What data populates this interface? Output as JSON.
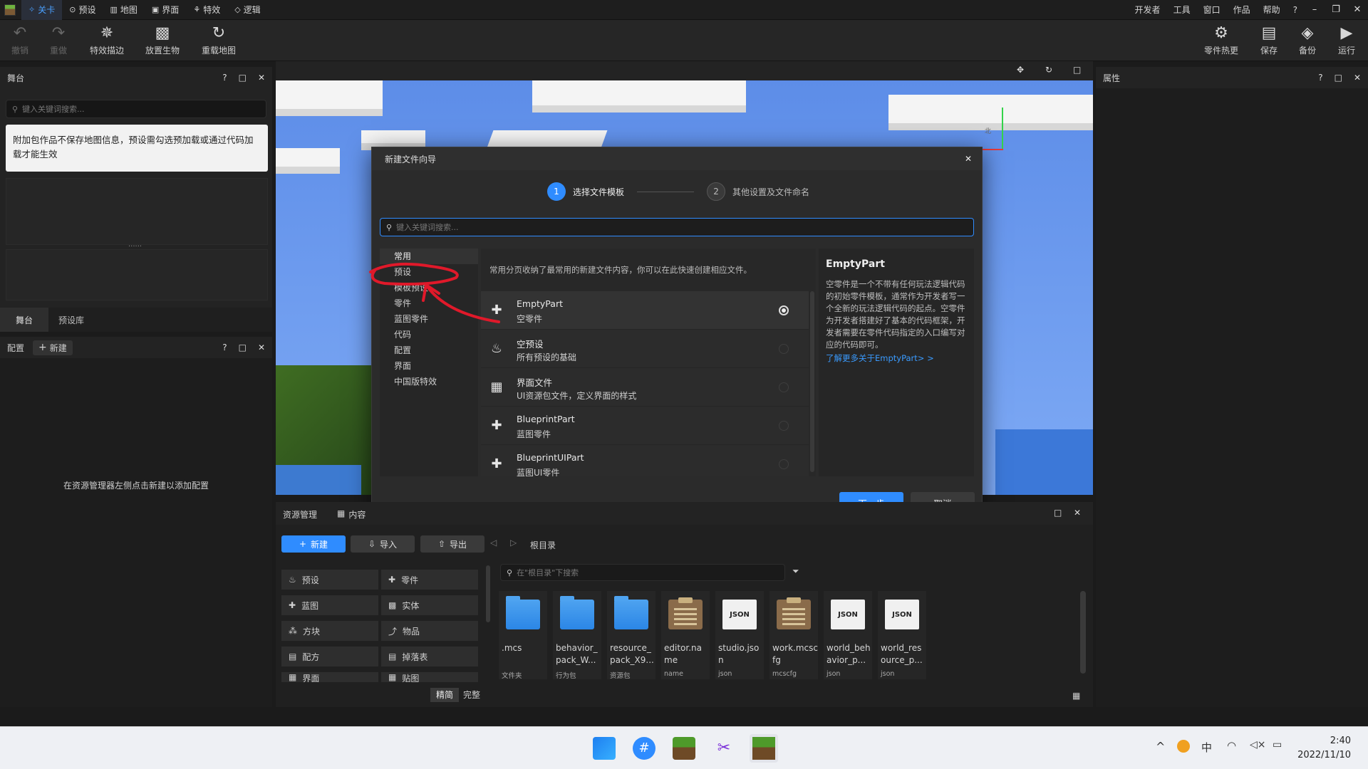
{
  "menubar": {
    "tabs": [
      {
        "label": "关卡",
        "icon": "level-icon",
        "active": true
      },
      {
        "label": "预设",
        "icon": "preset-icon"
      },
      {
        "label": "地图",
        "icon": "map-icon"
      },
      {
        "label": "界面",
        "icon": "ui-icon"
      },
      {
        "label": "特效",
        "icon": "effect-icon"
      },
      {
        "label": "逻辑",
        "icon": "logic-icon"
      }
    ],
    "right_items": [
      "开发者",
      "工具",
      "窗口",
      "作品",
      "帮助",
      "?"
    ]
  },
  "toolbar": {
    "undo": "撤销",
    "redo": "重做",
    "effect_stroke": "特效描边",
    "place_mob": "放置生物",
    "reload_map": "重载地图",
    "part_hotfix": "零件热更",
    "save": "保存",
    "backup": "备份",
    "run": "运行"
  },
  "stage_panel": {
    "title": "舞台",
    "search_placeholder": "键入关键词搜索...",
    "notice": "附加包作品不保存地图信息，预设需勾选预加载或通过代码加载才能生效",
    "splitter": "......",
    "tabs": [
      "舞台",
      "预设库"
    ]
  },
  "config_panel": {
    "title": "配置",
    "new_label": "新建",
    "empty_hint": "在资源管理器左侧点击新建以添加配置"
  },
  "properties_panel": {
    "title": "属性"
  },
  "viewport": {
    "gizmo_label": "北"
  },
  "dialog": {
    "title": "新建文件向导",
    "steps": [
      {
        "num": "1",
        "label": "选择文件模板"
      },
      {
        "num": "2",
        "label": "其他设置及文件命名"
      }
    ],
    "search_placeholder": "键入关键词搜索...",
    "categories": [
      "常用",
      "预设",
      "模板预设",
      "零件",
      "蓝图零件",
      "代码",
      "配置",
      "界面",
      "中国版特效"
    ],
    "description": "常用分页收纳了最常用的新建文件内容，你可以在此快速创建相应文件。",
    "templates": [
      {
        "name": "EmptyPart",
        "sub": "空零件",
        "selected": true
      },
      {
        "name": "空预设",
        "sub": "所有预设的基础",
        "selected": false
      },
      {
        "name": "界面文件",
        "sub": "UI资源包文件，定义界面的样式",
        "selected": false
      },
      {
        "name": "BlueprintPart",
        "sub": "蓝图零件",
        "selected": false
      },
      {
        "name": "BlueprintUIPart",
        "sub": "蓝图UI零件",
        "selected": false
      }
    ],
    "detail_title": "EmptyPart",
    "detail_text": "空零件是一个不带有任何玩法逻辑代码的初始零件模板，通常作为开发者写一个全新的玩法逻辑代码的起点。空零件为开发者搭建好了基本的代码框架，开发者需要在零件代码指定的入口编写对应的代码即可。",
    "detail_link": "了解更多关于EmptyPart> >",
    "next_button": "下一步",
    "cancel_button": "取消"
  },
  "assets": {
    "tab_label": "资源管理",
    "content_label": "内容",
    "new_button": "新建",
    "import_button": "导入",
    "export_button": "导出",
    "path": "根目录",
    "search_placeholder": "在\"根目录\"下搜索",
    "categories": [
      [
        "预设",
        "零件"
      ],
      [
        "蓝图",
        "实体"
      ],
      [
        "方块",
        "物品"
      ],
      [
        "配方",
        "掉落表"
      ],
      [
        "界面",
        "贴图"
      ]
    ],
    "view_modes": [
      "精简",
      "完整"
    ],
    "files": [
      {
        "name": ".mcs",
        "type": "文件夹",
        "kind": "folder"
      },
      {
        "name": "behavior_pack_W...",
        "type": "行为包",
        "kind": "folder"
      },
      {
        "name": "resource_pack_X9...",
        "type": "资源包",
        "kind": "folder"
      },
      {
        "name": "editor.name",
        "type": "name",
        "kind": "clip"
      },
      {
        "name": "studio.json",
        "type": "json",
        "kind": "json"
      },
      {
        "name": "work.mcscfg",
        "type": "mcscfg",
        "kind": "clip"
      },
      {
        "name": "world_behavior_p...",
        "type": "json",
        "kind": "json"
      },
      {
        "name": "world_resource_p...",
        "type": "json",
        "kind": "json"
      }
    ]
  },
  "taskbar": {
    "time": "2:40",
    "date": "2022/11/10",
    "ime": "中"
  },
  "colors": {
    "accent": "#2f8cff",
    "annotation": "#e0192a"
  }
}
